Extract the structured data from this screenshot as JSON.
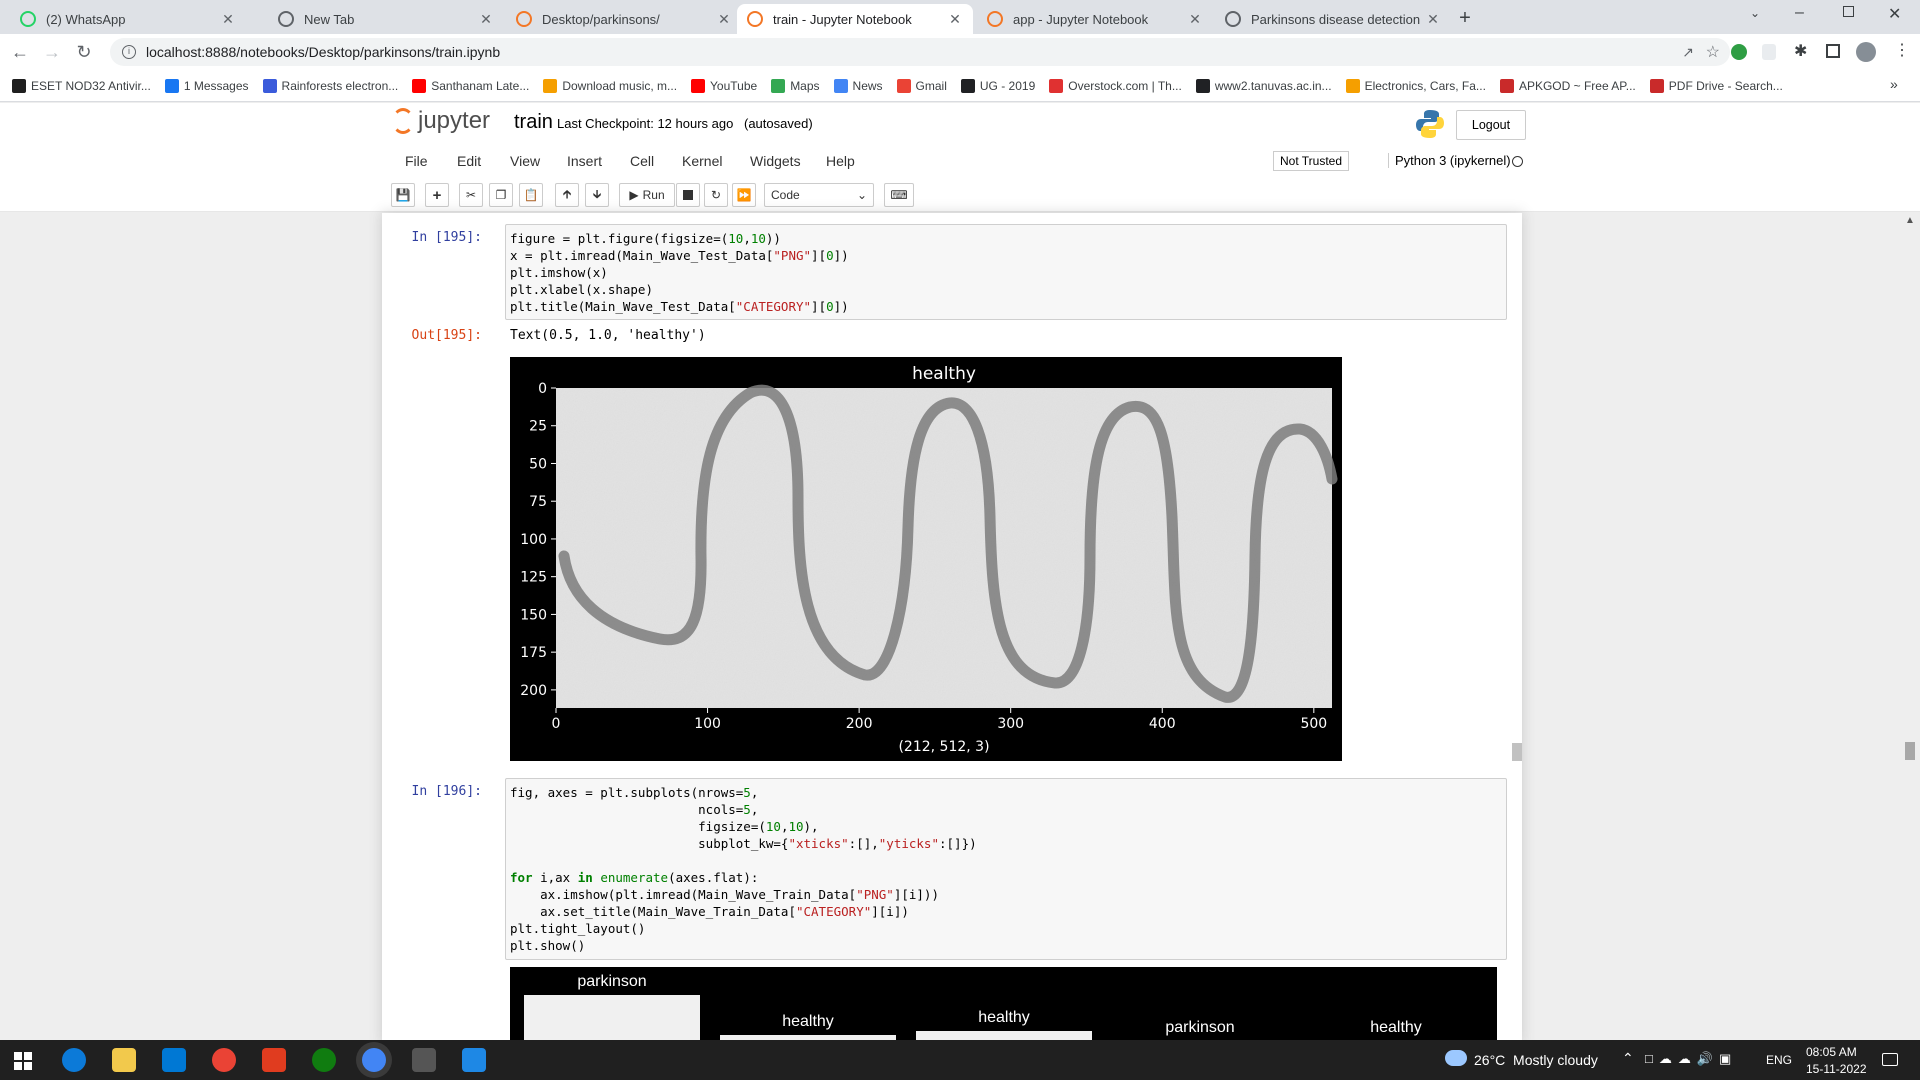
{
  "browser": {
    "tabs": [
      {
        "title": "(2) WhatsApp",
        "icon": "whatsapp-icon",
        "active": false
      },
      {
        "title": "New Tab",
        "icon": "chrome-icon",
        "active": false
      },
      {
        "title": "Desktop/parkinsons/",
        "icon": "jupyter-icon",
        "active": false
      },
      {
        "title": "train - Jupyter Notebook",
        "icon": "jupyter-icon",
        "active": true
      },
      {
        "title": "app - Jupyter Notebook",
        "icon": "jupyter-icon",
        "active": false
      },
      {
        "title": "Parkinsons disease detection",
        "icon": "chrome-icon",
        "active": false
      }
    ],
    "url": "localhost:8888/notebooks/Desktop/parkinsons/train.ipynb",
    "bookmarks": [
      {
        "label": "ESET NOD32 Antivir...",
        "color": "#1f1f1f"
      },
      {
        "label": "1 Messages",
        "color": "#1877f2"
      },
      {
        "label": "Rainforests electron...",
        "color": "#3b5bdb"
      },
      {
        "label": "Santhanam Late...",
        "color": "#ff0000"
      },
      {
        "label": "Download music, m...",
        "color": "#f59f00"
      },
      {
        "label": "YouTube",
        "color": "#ff0000"
      },
      {
        "label": "Maps",
        "color": "#34a853"
      },
      {
        "label": "News",
        "color": "#4285f4"
      },
      {
        "label": "Gmail",
        "color": "#ea4335"
      },
      {
        "label": "UG - 2019",
        "color": "#202124"
      },
      {
        "label": "Overstock.com | Th...",
        "color": "#e03131"
      },
      {
        "label": "www2.tanuvas.ac.in...",
        "color": "#202124"
      },
      {
        "label": "Electronics, Cars, Fa...",
        "color": "#f59f00"
      },
      {
        "label": "APKGOD ~ Free AP...",
        "color": "#c92a2a"
      },
      {
        "label": "PDF Drive - Search...",
        "color": "#c92a2a"
      }
    ]
  },
  "jupyter": {
    "logo_text": "jupyter",
    "notebook_name": "train",
    "checkpoint": "Last Checkpoint: 12 hours ago",
    "autosave": "(autosaved)",
    "logout": "Logout",
    "menus": [
      "File",
      "Edit",
      "View",
      "Insert",
      "Cell",
      "Kernel",
      "Widgets",
      "Help"
    ],
    "trust": "Not Trusted",
    "kernel": "Python 3 (ipykernel)",
    "run_label": "Run",
    "cell_type": "Code"
  },
  "cells": {
    "c195": {
      "in_prompt": "In [195]:",
      "code_lines": [
        "figure = plt.figure(figsize=(10,10))",
        "x = plt.imread(Main_Wave_Test_Data[\"PNG\"][0])",
        "plt.imshow(x)",
        "plt.xlabel(x.shape)",
        "plt.title(Main_Wave_Test_Data[\"CATEGORY\"][0])"
      ],
      "out_prompt": "Out[195]:",
      "out_text": "Text(0.5, 1.0, 'healthy')"
    },
    "c196": {
      "in_prompt": "In [196]:",
      "code_lines": [
        "fig, axes = plt.subplots(nrows=5,",
        "                         ncols=5,",
        "                         figsize=(10,10),",
        "                         subplot_kw={\"xticks\":[],\"yticks\":[]})",
        "",
        "for i,ax in enumerate(axes.flat):",
        "    ax.imshow(plt.imread(Main_Wave_Train_Data[\"PNG\"][i]))",
        "    ax.set_title(Main_Wave_Train_Data[\"CATEGORY\"][i])",
        "plt.tight_layout()",
        "plt.show()"
      ],
      "subplot_titles": [
        "parkinson",
        "healthy",
        "healthy",
        "parkinson",
        "healthy"
      ]
    }
  },
  "chart_data": {
    "type": "image",
    "title": "healthy",
    "xlabel": "(212, 512, 3)",
    "ylabel": "",
    "xticks": [
      "0",
      "100",
      "200",
      "300",
      "400",
      "500"
    ],
    "yticks": [
      "0",
      "25",
      "50",
      "75",
      "100",
      "125",
      "150",
      "175",
      "200"
    ],
    "xlim": [
      0,
      512
    ],
    "ylim": [
      212,
      0
    ]
  },
  "taskbar": {
    "weather": "26°C  Mostly cloudy",
    "lang": "ENG",
    "time": "08:05 AM",
    "date": "15-11-2022"
  }
}
